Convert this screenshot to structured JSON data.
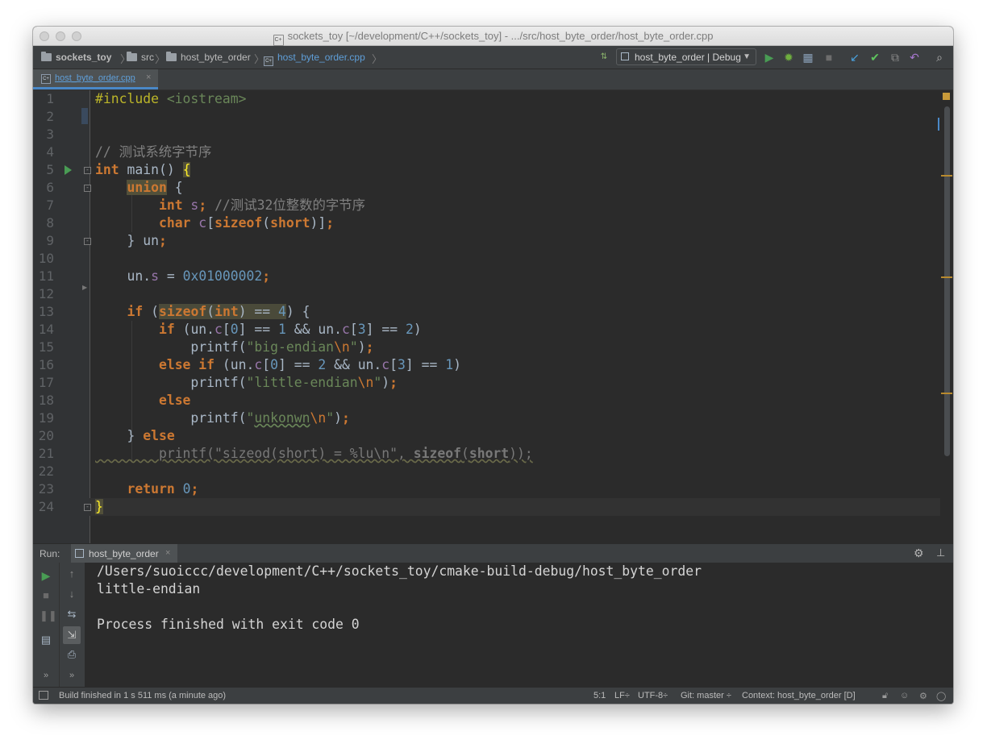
{
  "window": {
    "title": "sockets_toy [~/development/C++/sockets_toy] - .../src/host_byte_order/host_byte_order.cpp"
  },
  "breadcrumb": {
    "project": "sockets_toy",
    "folder1": "src",
    "folder2": "host_byte_order",
    "file": "host_byte_order.cpp"
  },
  "toolbar": {
    "run_config": "host_byte_order | Debug"
  },
  "editor_tab": {
    "label": "host_byte_order.cpp",
    "close": "×"
  },
  "editor": {
    "line_numbers": [
      "1",
      "2",
      "3",
      "4",
      "5",
      "6",
      "7",
      "8",
      "9",
      "10",
      "11",
      "12",
      "13",
      "14",
      "15",
      "16",
      "17",
      "18",
      "19",
      "20",
      "21",
      "22",
      "23",
      "24"
    ],
    "lines": {
      "l1_a": "#include ",
      "l1_b": "<iostream>",
      "l4": "// 测试系统字节序",
      "l5_kw": "int",
      "l5_rest": " main() ",
      "l5_brace": "{",
      "l6_kw": "union",
      "l6_rest": " {",
      "l7_kw": "int",
      "l7_fld": " s",
      "l7_semi": "; ",
      "l7_cm": "//测试32位整数的字节序",
      "l8_kw": "char",
      "l8_fld": " c",
      "l8_b1": "[",
      "l8_kw2": "sizeof",
      "l8_p1": "(",
      "l8_kw3": "short",
      "l8_p2": ")]",
      "l8_semi": ";",
      "l9_a": "} un",
      "l9_semi": ";",
      "l11_a": "un.",
      "l11_fld": "s",
      "l11_b": " = ",
      "l11_num": "0x01000002",
      "l11_semi": ";",
      "l13_kw": "if",
      "l13_a": " (",
      "l13_kw2": "sizeof",
      "l13_b": "(",
      "l13_kw3": "int",
      "l13_c": ") == ",
      "l13_num": "4",
      "l13_d": ") {",
      "l14_kw": "if",
      "l14_a": " (un.",
      "l14_fld": "c",
      "l14_b": "[",
      "l14_n1": "0",
      "l14_c": "] == ",
      "l14_n2": "1",
      "l14_d": " && un.",
      "l14_fld2": "c",
      "l14_e": "[",
      "l14_n3": "3",
      "l14_f": "] == ",
      "l14_n4": "2",
      "l14_g": ")",
      "l15_a": "printf(",
      "l15_str": "\"big-endian",
      "l15_esc": "\\n",
      "l15_str2": "\"",
      "l15_b": ")",
      "l15_semi": ";",
      "l16_kw": "else if",
      "l16_a": " (un.",
      "l16_fld": "c",
      "l16_b": "[",
      "l16_n1": "0",
      "l16_c": "] == ",
      "l16_n2": "2",
      "l16_d": " && un.",
      "l16_fld2": "c",
      "l16_e": "[",
      "l16_n3": "3",
      "l16_f": "] == ",
      "l16_n4": "1",
      "l16_g": ")",
      "l17_a": "printf(",
      "l17_str": "\"little-endian",
      "l17_esc": "\\n",
      "l17_str2": "\"",
      "l17_b": ")",
      "l17_semi": ";",
      "l18_kw": "else",
      "l19_a": "printf(",
      "l19_str": "\"",
      "l19_sq": "unkonwn",
      "l19_esc": "\\n",
      "l19_str2": "\"",
      "l19_b": ")",
      "l19_semi": ";",
      "l20_a": "} ",
      "l20_kw": "else",
      "l21_a": "printf(\"sizeod(short) = %lu\\n\", ",
      "l21_kw": "sizeof",
      "l21_b": "(",
      "l21_kw2": "short",
      "l21_c": "));",
      "l23_kw": "return",
      "l23_sp": " ",
      "l23_num": "0",
      "l23_semi": ";",
      "l24": "}"
    }
  },
  "run_panel": {
    "label": "Run:",
    "tab": "host_byte_order",
    "close": "×",
    "output": [
      "/Users/suoiccc/development/C++/sockets_toy/cmake-build-debug/host_byte_order",
      "little-endian",
      "",
      "Process finished with exit code 0"
    ]
  },
  "status": {
    "message": "Build finished in 1 s 511 ms (a minute ago)",
    "position": "5:1",
    "line_ending": "LF÷",
    "encoding": "UTF-8÷",
    "git": "Git: master ÷",
    "context": "Context: host_byte_order [D]"
  },
  "icons": [
    "folder-icon",
    "cpp-file-icon",
    "run-icon",
    "debug-icon",
    "coverage-icon",
    "stop-icon",
    "vcs-update-icon",
    "vcs-commit-icon",
    "vcs-history-icon",
    "revert-icon",
    "search-icon",
    "gear-icon",
    "hide-panel-icon",
    "rerun-icon",
    "scroll-up-icon",
    "scroll-down-icon",
    "pause-icon",
    "wrap-icon",
    "print-icon",
    "lock-icon",
    "inspector-icon",
    "hector-icon",
    "event-log-icon"
  ],
  "colors": {
    "keyword": "#cc7832",
    "string": "#6a8759",
    "number": "#6897bb",
    "field": "#9876aa",
    "comment": "#808080",
    "preprocessor": "#bbb529",
    "background": "#2b2b2b",
    "run_green": "#499c54"
  }
}
